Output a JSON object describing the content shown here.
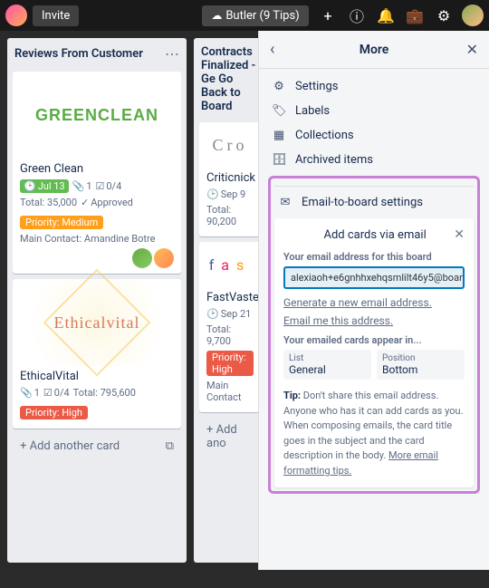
{
  "topbar": {
    "invite": "Invite",
    "butler": "Butler (9 Tips)"
  },
  "lists": [
    {
      "title": "Reviews From Customer",
      "cards": [
        {
          "cover": "GREENCLEAN",
          "title": "Green Clean",
          "due": "Jul 13",
          "attach": "1",
          "checklist": "0/4",
          "total": "Total: 35,000",
          "approved": "Approved",
          "label": "Priority: Medium",
          "contact": "Main Contact: Amandine Botre"
        },
        {
          "cover": "Ethicalvital",
          "title": "EthicalVital",
          "attach": "1",
          "checklist": "0/4",
          "total": "Total: 795,600",
          "label": "Priority: High"
        }
      ],
      "add": "Add another card"
    },
    {
      "title": "Contracts Finalized - Ge Go Back to Board",
      "cards": [
        {
          "cover": "Cro",
          "title": "Criticnick",
          "due": "Sep 9",
          "total": "Total: 90,200"
        },
        {
          "cover": "fas",
          "title": "FastVaste",
          "due": "Sep 21",
          "total": "Total: 9,700",
          "label": "Priority: High",
          "contact": "Main Contact"
        }
      ],
      "add": "Add ano"
    }
  ],
  "panel": {
    "title": "More",
    "menu": {
      "settings": "Settings",
      "labels": "Labels",
      "collections": "Collections",
      "archived": "Archived items",
      "emailBoard": "Email-to-board settings"
    },
    "email": {
      "heading": "Add cards via email",
      "addressLabel": "Your email address for this board",
      "address": "alexiaoh+e6gnhhxehqsmlilt46y5@boar",
      "generate": "Generate a new email address.",
      "emailMe": "Email me this address.",
      "appearLabel": "Your emailed cards appear in...",
      "listLabel": "List",
      "listValue": "General",
      "posLabel": "Position",
      "posValue": "Bottom",
      "tipBold": "Tip:",
      "tipText": " Don't share this email address. Anyone who has it can add cards as you. When composing emails, the card title goes in the subject and the card description in the body. ",
      "tipLink": "More email formatting tips."
    }
  }
}
